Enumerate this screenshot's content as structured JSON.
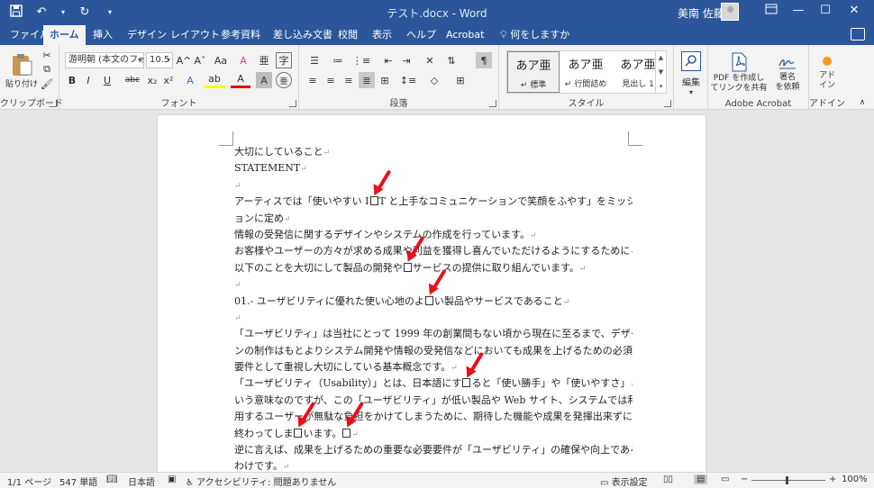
{
  "window": {
    "doc_title": "テスト.docx - Word",
    "user_name": "美南 佐藤",
    "quick_access": {
      "save_icon": "save-icon",
      "undo_icon": "undo-icon",
      "redo_icon": "redo-icon"
    }
  },
  "tabs": [
    "ファイル",
    "ホーム",
    "挿入",
    "デザイン",
    "レイアウト",
    "参考資料",
    "差し込み文書",
    "校閲",
    "表示",
    "ヘルプ",
    "Acrobat",
    "何をしますか"
  ],
  "active_tab": "ホーム",
  "ribbon": {
    "clipboard": {
      "paste_label": "貼り付け",
      "group_label": "クリップボード"
    },
    "font": {
      "font_name": "游明朝 (本文のフォ",
      "font_size": "10.5",
      "group_label": "フォント",
      "bold": "B",
      "italic": "I",
      "underline": "U",
      "strike": "abc",
      "subscript": "x₂",
      "superscript": "x²",
      "grow": "A^",
      "shrink": "Aˇ",
      "case": "Aa",
      "clear": "A",
      "color": "A",
      "highlight": "ab",
      "phonetic": "亜",
      "enclosed": "字"
    },
    "paragraph": {
      "group_label": "段落"
    },
    "styles": {
      "group_label": "スタイル",
      "items": [
        {
          "sample": "あア亜",
          "name": "↵ 標準"
        },
        {
          "sample": "あア亜",
          "name": "↵ 行間詰め"
        },
        {
          "sample": "あア亜",
          "name": "見出し 1"
        }
      ]
    },
    "editing": {
      "label": "編集"
    },
    "acrobat": {
      "create_pdf": "PDF を作成し\nてリンクを共有",
      "sign": "署名\nを依頼",
      "group_label": "Adobe Acrobat"
    },
    "addins": {
      "label": "アド\nイン",
      "group_label": "アドイン"
    }
  },
  "document": {
    "lines": [
      {
        "t": "大切にしていること",
        "pm": "↵"
      },
      {
        "t": "STATEMENT",
        "pm": "↵"
      },
      {
        "t": "",
        "pm": "↵"
      },
      {
        "t": "アーティスでは「使いやすい I□T と上手なコミュニケーションで笑顔をふやす」をミッシ",
        "pm": "",
        "just": true
      },
      {
        "t": "ョンに定め",
        "pm": "↵"
      },
      {
        "t": "情報の受発信に関するデザインやシステムの作成を行っています。",
        "pm": "↵"
      },
      {
        "t": "お客様やユーザーの方々が求める成果や利益を獲得し喜んでいただけるようにするために",
        "pm": "↵"
      },
      {
        "t": "以下のことを大切にして製品の開発や□サービスの提供に取り組んでいます。",
        "pm": "↵"
      },
      {
        "t": "",
        "pm": "↵"
      },
      {
        "t": "01.- ユーザビリティに優れた使い心地のよ□い製品やサービスであること",
        "pm": "↵"
      },
      {
        "t": "",
        "pm": "↵"
      },
      {
        "t": "「ユーザビリティ」は当社にとって 1999 年の創業間もない頃から現在に至るまで、デザイ",
        "pm": "",
        "just": true
      },
      {
        "t": "ンの制作はもとよりシステム開発や情報の受発信などにおいても成果を上げるための必須",
        "pm": "",
        "just": true
      },
      {
        "t": "要件として重視し大切にしている基本概念です。",
        "pm": "↵"
      },
      {
        "t": "「ユーザビリティ（Usability）」とは、日本語にす□ると「使い勝手」や「使いやすさ」と",
        "pm": "",
        "just": true
      },
      {
        "t": "いう意味なのですが、この「ユーザビリティ」が低い製品や Web サイト、システムでは利",
        "pm": "",
        "just": true
      },
      {
        "t": "用するユーザーが無駄な負担をかけてしまうために、期待した機能や成果を発揮出来ずに",
        "pm": "",
        "just": true
      },
      {
        "t": "終わってしま□います。□",
        "pm": "↵"
      },
      {
        "t": "逆に言えば、成果を上げるための重要な必要要件が「ユーザビリティ」の確保や向上である",
        "pm": "",
        "just": true
      },
      {
        "t": "わけです。",
        "pm": "↵"
      }
    ]
  },
  "annotations": {
    "arrow_color": "#e8101c",
    "count": 6
  },
  "status": {
    "page": "1/1 ページ",
    "words": "547 単語",
    "language": "日本語",
    "accessibility": "アクセシビリティ: 問題ありません",
    "display_settings": "表示設定",
    "zoom": "100%",
    "zoom_minus": "−",
    "zoom_plus": "+"
  },
  "colors": {
    "brand": "#2b579a",
    "ribbon_bg": "#f3f3f3",
    "canvas": "#e6e6e6"
  }
}
